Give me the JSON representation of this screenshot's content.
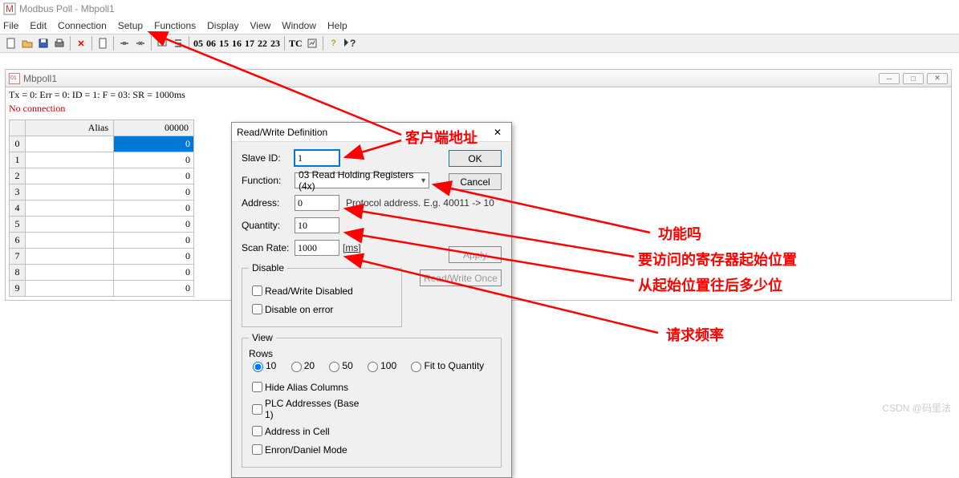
{
  "app": {
    "title": "Modbus Poll - Mbpoll1"
  },
  "menu": [
    "File",
    "Edit",
    "Connection",
    "Setup",
    "Functions",
    "Display",
    "View",
    "Window",
    "Help"
  ],
  "toolbar_codes": [
    "05",
    "06",
    "15",
    "16",
    "17",
    "22",
    "23"
  ],
  "toolbar_tc": "TC",
  "docwin": {
    "title": "Mbpoll1",
    "status": "Tx = 0: Err = 0: ID = 1: F = 03: SR = 1000ms",
    "noconn": "No connection"
  },
  "grid": {
    "headers": {
      "alias": "Alias",
      "col0": "00000"
    },
    "rows": [
      {
        "idx": "0",
        "val": "0",
        "selected": true
      },
      {
        "idx": "1",
        "val": "0"
      },
      {
        "idx": "2",
        "val": "0"
      },
      {
        "idx": "3",
        "val": "0"
      },
      {
        "idx": "4",
        "val": "0"
      },
      {
        "idx": "5",
        "val": "0"
      },
      {
        "idx": "6",
        "val": "0"
      },
      {
        "idx": "7",
        "val": "0"
      },
      {
        "idx": "8",
        "val": "0"
      },
      {
        "idx": "9",
        "val": "0"
      }
    ]
  },
  "dialog": {
    "title": "Read/Write Definition",
    "labels": {
      "slave": "Slave ID:",
      "function": "Function:",
      "address": "Address:",
      "quantity": "Quantity:",
      "scanrate": "Scan Rate:"
    },
    "values": {
      "slave": "1",
      "function": "03 Read Holding Registers (4x)",
      "address": "0",
      "quantity": "10",
      "scanrate": "1000",
      "scanrate_unit": "[ms]"
    },
    "hint_protocol": "Protocol address. E.g. 40011 -> 10",
    "buttons": {
      "ok": "OK",
      "cancel": "Cancel",
      "apply": "Apply",
      "rwonce": "Read/Write Once"
    },
    "disable": {
      "legend": "Disable",
      "rw_disabled": "Read/Write Disabled",
      "on_error": "Disable on error"
    },
    "view": {
      "legend": "View",
      "rows_label": "Rows",
      "options": [
        "10",
        "20",
        "50",
        "100",
        "Fit to Quantity"
      ],
      "hide_alias": "Hide Alias Columns",
      "plc_addr": "PLC Addresses (Base 1)",
      "addr_cell": "Address in Cell",
      "enron": "Enron/Daniel Mode"
    }
  },
  "annotations": {
    "client_addr": "客户端地址",
    "function_q": "功能吗",
    "reg_start": "要访问的寄存器起始位置",
    "count": "从起始位置往后多少位",
    "freq": "请求频率"
  },
  "watermark": "CSDN @码里法"
}
